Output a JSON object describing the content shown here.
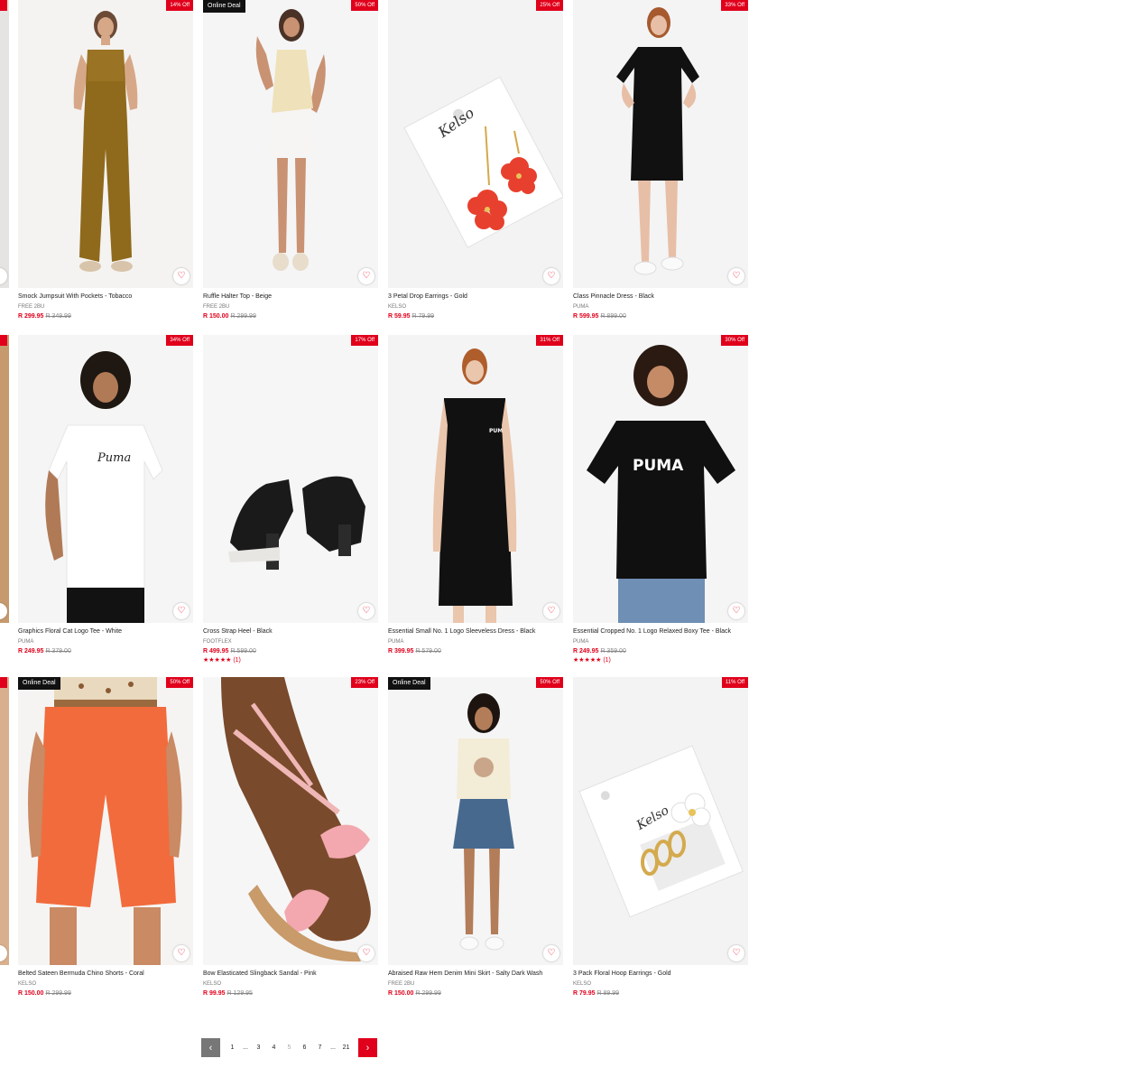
{
  "colors": {
    "accent": "#e0001b",
    "deal": "#111111",
    "image_bg": "#f4f4f2"
  },
  "rows": [
    {
      "edge_badge": "Off",
      "products": [
        {
          "title": "Smock Jumpsuit With Pockets - Tobacco",
          "brand": "FREE 2BU",
          "price": "R 299.95",
          "was": "R 349.99",
          "discount": "14% Off",
          "deal": "",
          "rating": "",
          "image": "model-jumpsuit-tobacco",
          "icon": "heart-icon"
        },
        {
          "title": "Ruffle Halter Top - Beige",
          "brand": "FREE 2BU",
          "price": "R 150.00",
          "was": "R 299.99",
          "discount": "50% Off",
          "deal": "Online Deal",
          "rating": "",
          "image": "model-halter-top-beige",
          "icon": "heart-icon"
        },
        {
          "title": "3 Petal Drop Earrings - Gold",
          "brand": "KELSO",
          "price": "R 59.95",
          "was": "R 79.99",
          "discount": "25% Off",
          "deal": "",
          "rating": "",
          "image": "earrings-red-flower-card",
          "icon": "heart-icon"
        },
        {
          "title": "Class Pinnacle Dress - Black",
          "brand": "PUMA",
          "price": "R 599.95",
          "was": "R 899.00",
          "discount": "33% Off",
          "deal": "",
          "rating": "",
          "image": "model-dress-black",
          "icon": "heart-icon"
        }
      ]
    },
    {
      "edge_badge": "Off",
      "products": [
        {
          "title": "Graphics Floral Cat Logo Tee - White",
          "brand": "PUMA",
          "price": "R 249.95",
          "was": "R 379.00",
          "discount": "34% Off",
          "deal": "",
          "rating": "",
          "image": "model-tee-white",
          "icon": "heart-icon"
        },
        {
          "title": "Cross Strap Heel - Black",
          "brand": "FOOTFLEX",
          "price": "R 499.95",
          "was": "R 599.00",
          "discount": "17% Off",
          "deal": "",
          "rating": "★★★★★ (1)",
          "image": "shoe-black-heel",
          "icon": "heart-icon"
        },
        {
          "title": "Essential Small No. 1 Logo Sleeveless Dress - Black",
          "brand": "PUMA",
          "price": "R 399.95",
          "was": "R 579.00",
          "discount": "31% Off",
          "deal": "",
          "rating": "",
          "image": "model-sleeveless-dress-black",
          "icon": "heart-icon"
        },
        {
          "title": "Essential Cropped No. 1 Logo Relaxed Boxy Tee - Black",
          "brand": "PUMA",
          "price": "R 249.95",
          "was": "R 359.00",
          "discount": "30% Off",
          "deal": "",
          "rating": "★★★★★ (1)",
          "image": "model-tee-black",
          "icon": "heart-icon"
        }
      ]
    },
    {
      "edge_badge": "Off",
      "products": [
        {
          "title": "Belted Sateen Bermuda Chino Shorts - Coral",
          "brand": "KELSO",
          "price": "R 150.00",
          "was": "R 299.99",
          "discount": "50% Off",
          "deal": "Online Deal",
          "rating": "",
          "image": "model-shorts-coral",
          "icon": "heart-icon"
        },
        {
          "title": "Bow Elasticated Slingback Sandal - Pink",
          "brand": "KELSO",
          "price": "R 99.95",
          "was": "R 129.95",
          "discount": "23% Off",
          "deal": "",
          "rating": "",
          "image": "sandal-pink",
          "icon": "heart-icon"
        },
        {
          "title": "Abraised Raw Hem Denim Mini Skirt - Salty Dark Wash",
          "brand": "FREE 2BU",
          "price": "R 150.00",
          "was": "R 299.99",
          "discount": "50% Off",
          "deal": "Online Deal",
          "rating": "",
          "image": "model-denim-skirt",
          "icon": "heart-icon"
        },
        {
          "title": "3 Pack Floral Hoop Earrings - Gold",
          "brand": "KELSO",
          "price": "R 79.95",
          "was": "R 89.99",
          "discount": "11% Off",
          "deal": "",
          "rating": "",
          "image": "earrings-hoop-card",
          "icon": "heart-icon"
        }
      ]
    }
  ],
  "pagination": {
    "prev_icon": "chevron-left-icon",
    "next_icon": "chevron-right-icon",
    "prev": "‹",
    "next": "›",
    "pages": [
      "1",
      "...",
      "3",
      "4",
      "5",
      "6",
      "7",
      "...",
      "21"
    ],
    "current": "5"
  }
}
